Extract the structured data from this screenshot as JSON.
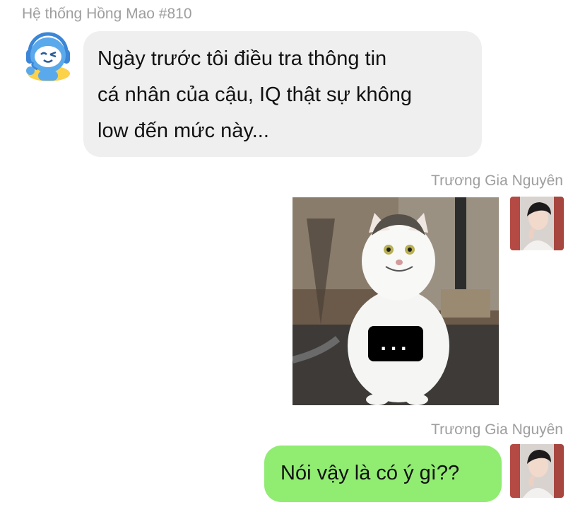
{
  "messages": [
    {
      "sender": "Hệ thống Hồng Mao #810",
      "avatar_icon": "robot-mascot-icon",
      "text_lines": [
        "Ngày trước tôi điều tra thông tin",
        "cá nhân của cậu, IQ thật sự không",
        "low đến mức này..."
      ]
    },
    {
      "sender": "Trương Gia Nguyên",
      "avatar_icon": "user-photo-avatar",
      "image": {
        "description_icon": "smiling-cat-photo",
        "overlay_text": "..."
      }
    },
    {
      "sender": "Trương Gia Nguyên",
      "avatar_icon": "user-photo-avatar",
      "text": "Nói vậy là có ý gì??"
    }
  ],
  "colors": {
    "received_bubble": "#efefef",
    "sent_bubble": "#91ec72",
    "name_text": "#9e9e9e",
    "robot_blue": "#5aa9ec"
  }
}
